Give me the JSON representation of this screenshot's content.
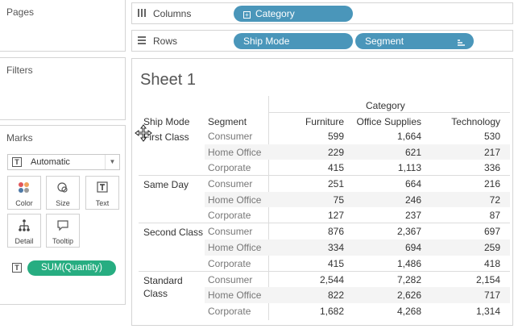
{
  "left_panel": {
    "pages_title": "Pages",
    "filters_title": "Filters",
    "marks_title": "Marks",
    "mark_type": "Automatic",
    "mark_buttons": [
      {
        "label": "Color",
        "icon": "color-icon"
      },
      {
        "label": "Size",
        "icon": "size-icon"
      },
      {
        "label": "Text",
        "icon": "text-icon"
      },
      {
        "label": "Detail",
        "icon": "detail-icon"
      },
      {
        "label": "Tooltip",
        "icon": "tooltip-icon"
      }
    ],
    "field": "SUM(Quantity)"
  },
  "shelves": {
    "columns_label": "Columns",
    "columns_pill": "Category",
    "rows_label": "Rows",
    "rows_pills": [
      "Ship Mode",
      "Segment"
    ]
  },
  "sheet": {
    "title": "Sheet 1",
    "category_header": "Category",
    "ship_mode_header": "Ship Mode",
    "segment_header": "Segment",
    "columns": [
      "Furniture",
      "Office Supplies",
      "Technology"
    ],
    "groups": [
      {
        "ship_mode": "First Class",
        "rows": [
          {
            "segment": "Consumer",
            "values": [
              "599",
              "1,664",
              "530"
            ]
          },
          {
            "segment": "Home Office",
            "values": [
              "229",
              "621",
              "217"
            ]
          },
          {
            "segment": "Corporate",
            "values": [
              "415",
              "1,113",
              "336"
            ]
          }
        ]
      },
      {
        "ship_mode": "Same Day",
        "rows": [
          {
            "segment": "Consumer",
            "values": [
              "251",
              "664",
              "216"
            ]
          },
          {
            "segment": "Home Office",
            "values": [
              "75",
              "246",
              "72"
            ]
          },
          {
            "segment": "Corporate",
            "values": [
              "127",
              "237",
              "87"
            ]
          }
        ]
      },
      {
        "ship_mode": "Second Class",
        "rows": [
          {
            "segment": "Consumer",
            "values": [
              "876",
              "2,367",
              "697"
            ]
          },
          {
            "segment": "Home Office",
            "values": [
              "334",
              "694",
              "259"
            ]
          },
          {
            "segment": "Corporate",
            "values": [
              "415",
              "1,486",
              "418"
            ]
          }
        ]
      },
      {
        "ship_mode": "Standard Class",
        "rows": [
          {
            "segment": "Consumer",
            "values": [
              "2,544",
              "7,282",
              "2,154"
            ]
          },
          {
            "segment": "Home Office",
            "values": [
              "822",
              "2,626",
              "717"
            ]
          },
          {
            "segment": "Corporate",
            "values": [
              "1,682",
              "4,268",
              "1,314"
            ]
          }
        ]
      }
    ]
  }
}
